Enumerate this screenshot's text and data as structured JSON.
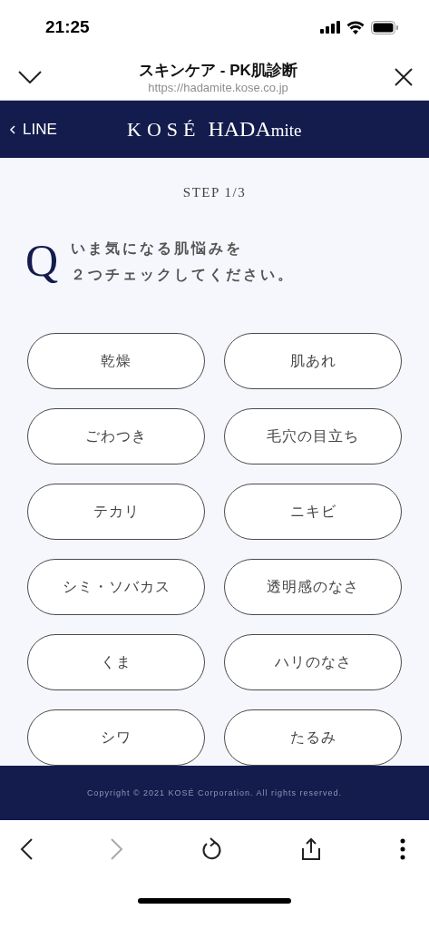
{
  "status_bar": {
    "time": "21:25"
  },
  "browser_header": {
    "title": "スキンケア - PK肌診断",
    "url": "https://hadamite.kose.co.jp"
  },
  "site_header": {
    "back_link": "LINE",
    "logo": {
      "brand": "KOSÉ",
      "name": "HADA",
      "suffix": "mite"
    }
  },
  "step": "STEP 1/3",
  "question": {
    "mark": "Q",
    "lines": [
      "いま気になる肌悩みを",
      "２つチェックしてください。"
    ]
  },
  "options": [
    {
      "label": "乾燥",
      "selected": false
    },
    {
      "label": "肌あれ",
      "selected": false
    },
    {
      "label": "ごわつき",
      "selected": false
    },
    {
      "label": "毛穴の目立ち",
      "selected": false
    },
    {
      "label": "テカリ",
      "selected": false
    },
    {
      "label": "ニキビ",
      "selected": false
    },
    {
      "label": "シミ・ソバカス",
      "selected": false
    },
    {
      "label": "透明感のなさ",
      "selected": false
    },
    {
      "label": "くま",
      "selected": false
    },
    {
      "label": "ハリのなさ",
      "selected": false
    },
    {
      "label": "シワ",
      "selected": false
    },
    {
      "label": "たるみ",
      "selected": false
    }
  ],
  "footer": {
    "copyright": "Copyright © 2021 KOSÉ Corporation. All rights reserved."
  },
  "toolbar": {
    "back_disabled": false,
    "forward_disabled": true
  }
}
